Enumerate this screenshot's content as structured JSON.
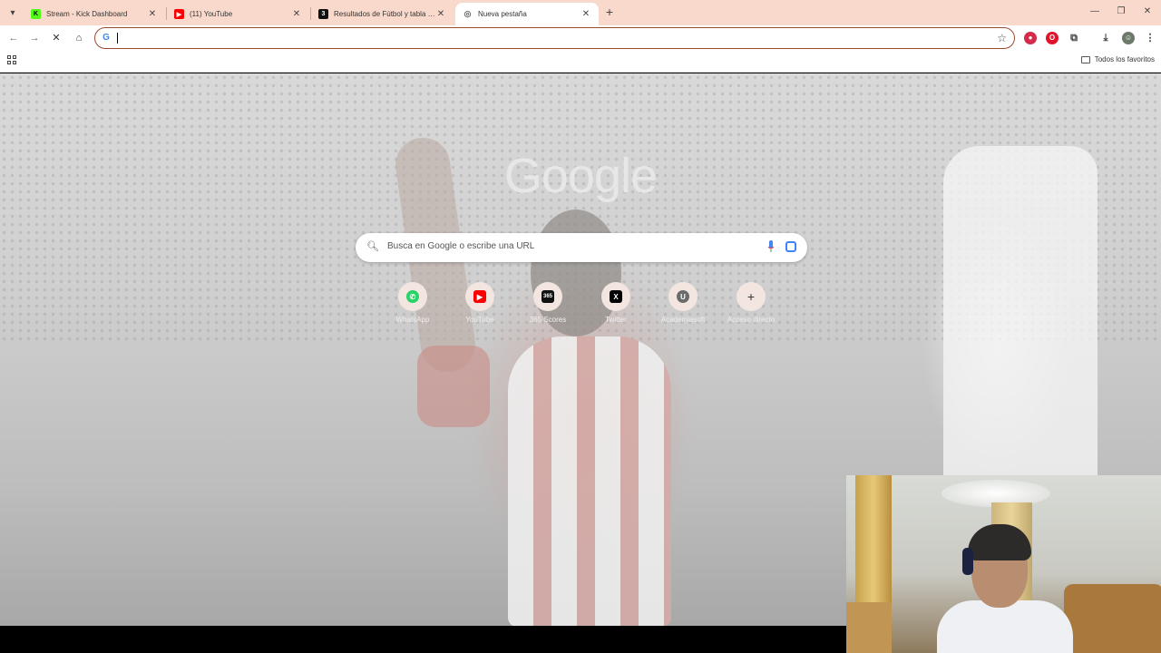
{
  "colors": {
    "tabstrip_bg": "#f9d9cc",
    "omnibox_border": "#9b4a2f",
    "accent_google_blue": "#4285f4"
  },
  "tabs": [
    {
      "title": "Stream - Kick Dashboard",
      "icon": "kick-icon",
      "fav": "K",
      "fav_color": "#53fc18",
      "active": false
    },
    {
      "title": "(11) YouTube",
      "icon": "youtube-icon",
      "fav": "▶",
      "fav_color": "#ff0000",
      "active": false
    },
    {
      "title": "Resultados de Fútbol y tabla de",
      "icon": "365scores-icon",
      "fav": "3",
      "fav_color": "#111111",
      "active": false
    },
    {
      "title": "Nueva pestaña",
      "icon": "chrome-newtab-icon",
      "fav": "◎",
      "fav_color": "#777777",
      "active": true
    }
  ],
  "toolbar": {
    "omnibox_value": "",
    "all_bookmarks_label": "Todos los favoritos"
  },
  "newtab": {
    "logo_text": "Google",
    "search_placeholder": "Busca en Google o escribe una URL",
    "shortcuts": [
      {
        "label": "WhatsApp",
        "icon": "whatsapp-icon",
        "glyph": "✆",
        "color": "#25d366"
      },
      {
        "label": "YouTube",
        "icon": "youtube-icon",
        "glyph": "▶",
        "color": "#ff0000"
      },
      {
        "label": "365 Scores",
        "icon": "365scores-icon",
        "glyph": "365",
        "color": "#111111"
      },
      {
        "label": "Twitter",
        "icon": "x-icon",
        "glyph": "X",
        "color": "#000000"
      },
      {
        "label": "Academiasoft",
        "icon": "letter-u-icon",
        "glyph": "U",
        "color": "#6b6b6b"
      },
      {
        "label": "Acceso directo",
        "icon": "plus-icon",
        "glyph": "+",
        "color": "#333333"
      }
    ]
  }
}
